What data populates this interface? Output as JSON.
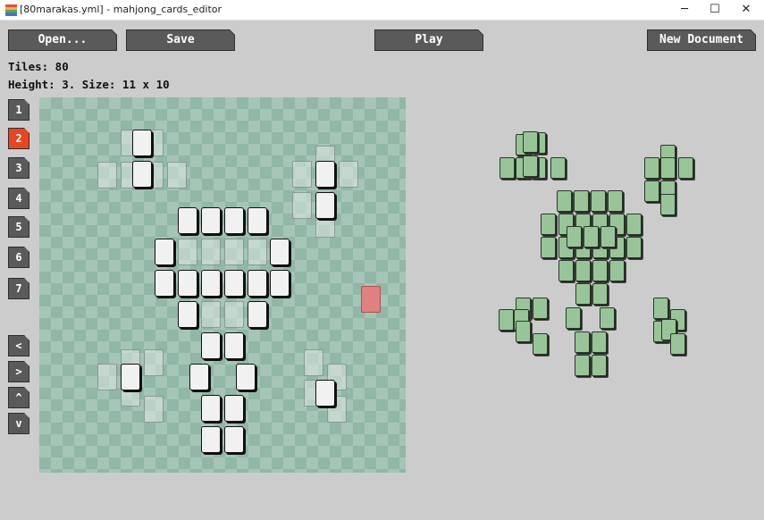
{
  "window": {
    "title": "[80marakas.yml] - mahjong_cards_editor",
    "min_glyph": "─",
    "max_glyph": "☐",
    "close_glyph": "✕"
  },
  "toolbar": {
    "open_label": "Open...",
    "save_label": "Save",
    "play_label": "Play",
    "new_label": "New Document"
  },
  "info": {
    "tiles": "Tiles: 80",
    "height_size": "Height: 3. Size: 11 x 10"
  },
  "layers": [
    "1",
    "2",
    "3",
    "4",
    "5",
    "6",
    "7"
  ],
  "active_layer": "2",
  "nav": [
    "<",
    ">",
    "^",
    "v"
  ],
  "colors": {
    "background": "#cccccc",
    "button": "#5a5a5a",
    "active_layer": "#e8461f",
    "grid_light": "#a5c5b6",
    "grid_dark": "#91b7a6",
    "preview_tile": "#97c597",
    "marker_tile": "#e08080"
  },
  "icons": {
    "app": "app-stripes-icon"
  }
}
